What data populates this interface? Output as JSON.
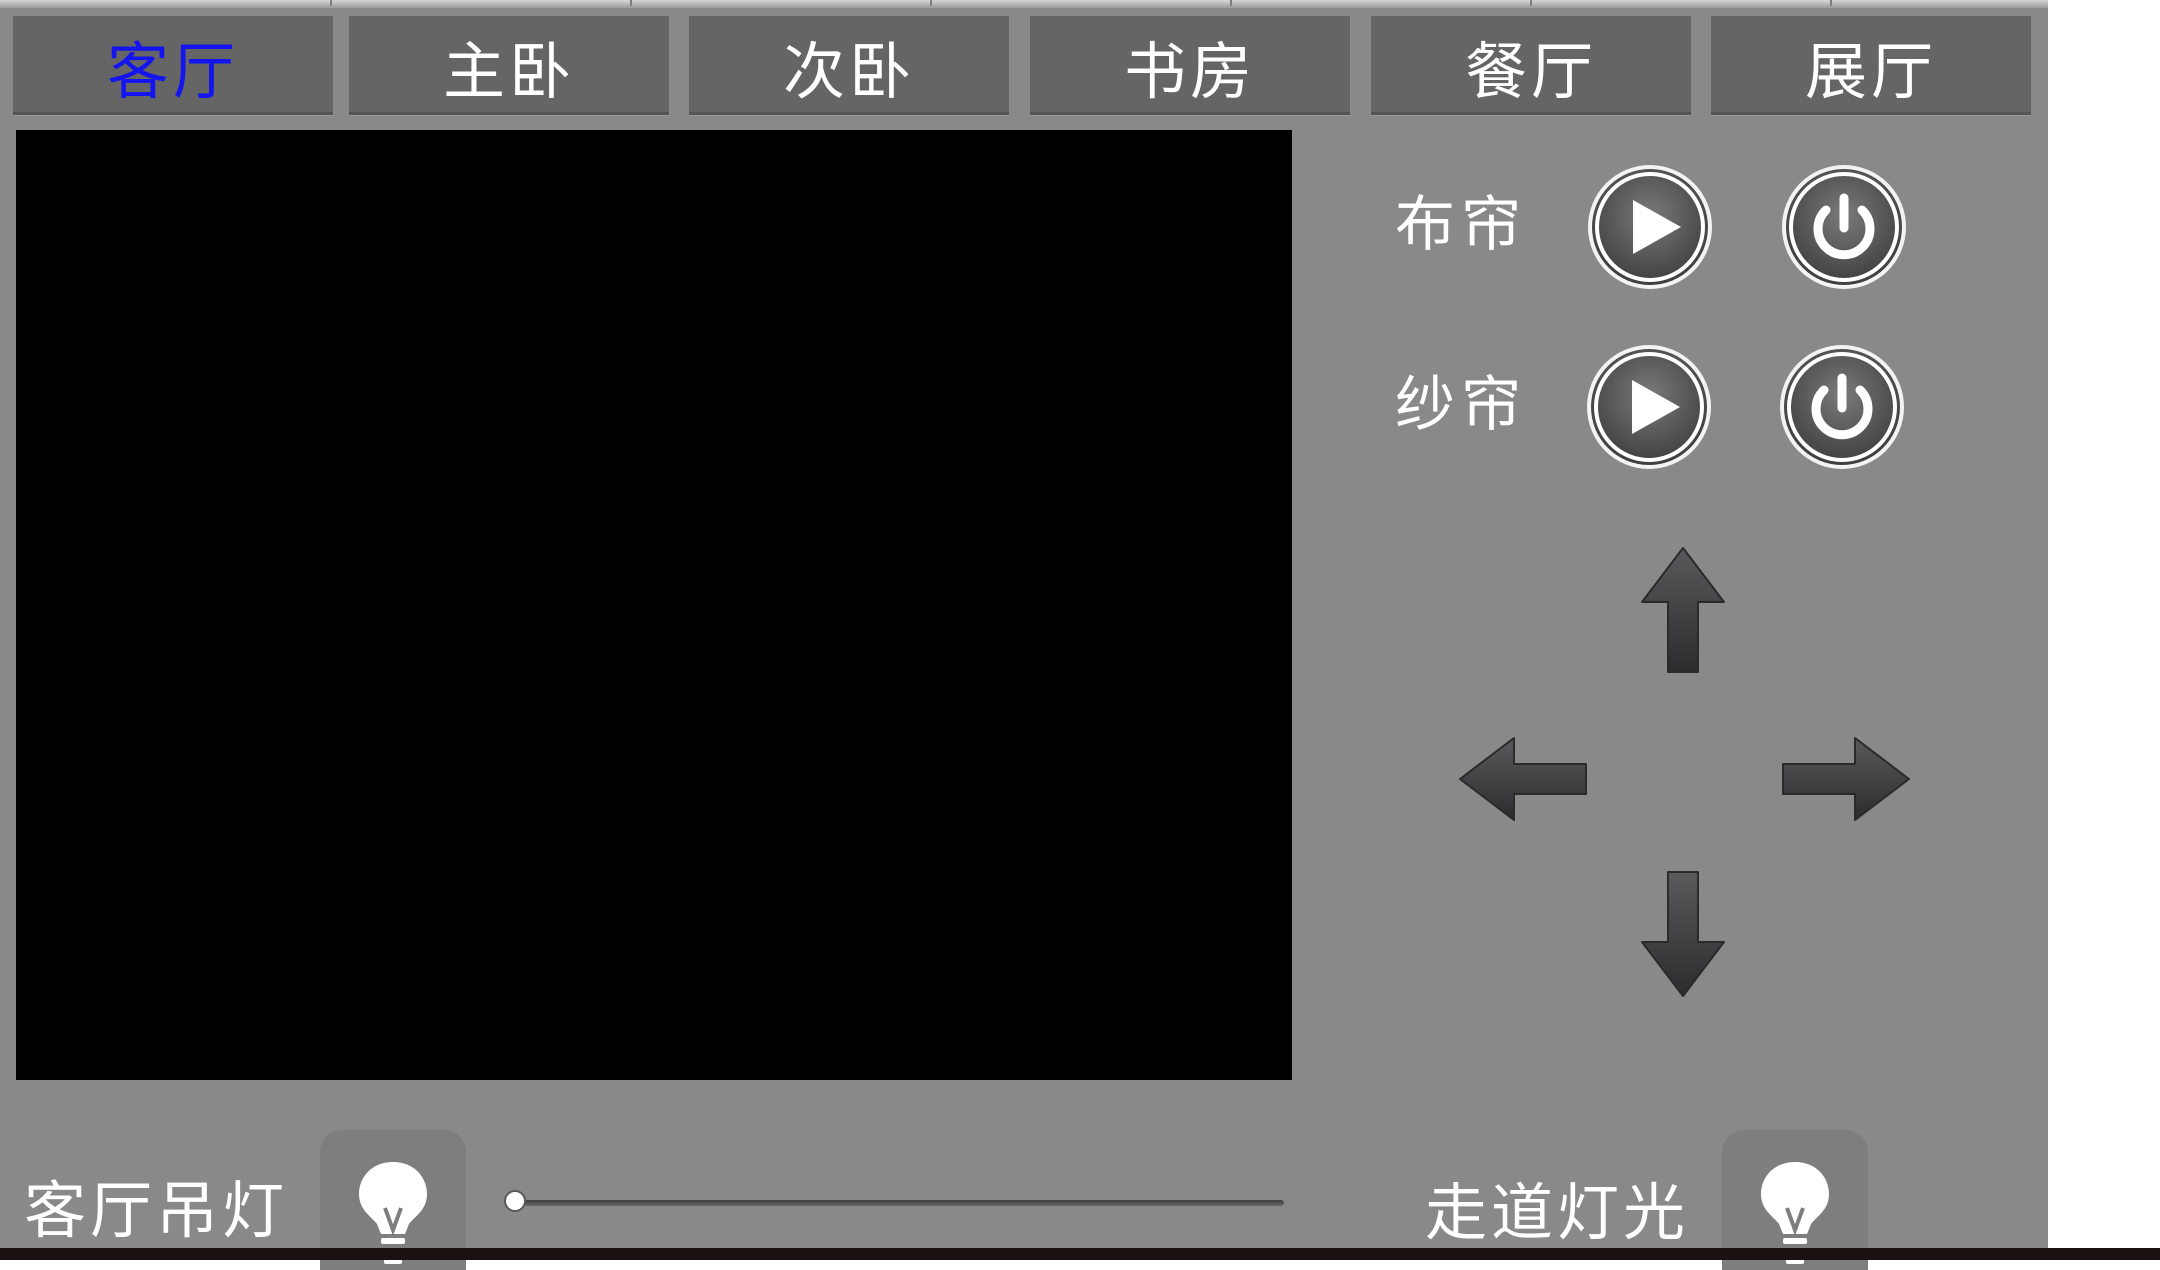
{
  "tabs": [
    {
      "label": "客厅",
      "active": true
    },
    {
      "label": "主卧",
      "active": false
    },
    {
      "label": "次卧",
      "active": false
    },
    {
      "label": "书房",
      "active": false
    },
    {
      "label": "餐厅",
      "active": false
    },
    {
      "label": "展厅",
      "active": false
    }
  ],
  "colors": {
    "panel_bg": "#8a898a",
    "tab_bg": "#656565",
    "active_tab_text": "#1414f0",
    "video_bg": "#000000"
  },
  "video": {
    "icon": "camera-feed"
  },
  "curtains": {
    "cloth": {
      "label": "布帘",
      "buttons": [
        "play-icon",
        "power-icon"
      ]
    },
    "sheer": {
      "label": "纱帘",
      "buttons": [
        "play-icon",
        "power-icon"
      ]
    }
  },
  "direction_pad": [
    "arrow-up-icon",
    "arrow-left-icon",
    "arrow-right-icon",
    "arrow-down-icon"
  ],
  "lights": {
    "chandelier": {
      "label": "客厅吊灯",
      "icon": "bulb-icon",
      "brightness_percent": 0
    },
    "corridor": {
      "label": "走道灯光",
      "icon": "bulb-icon"
    }
  }
}
